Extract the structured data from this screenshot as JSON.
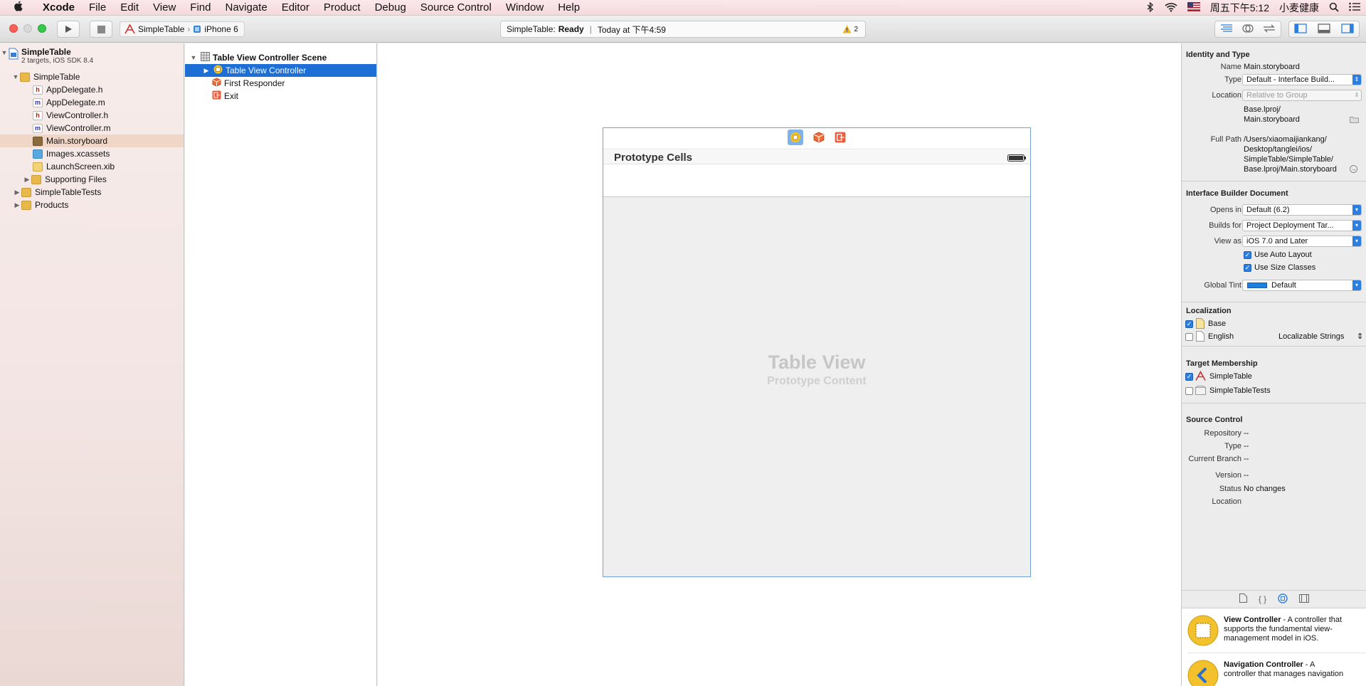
{
  "menubar": {
    "apple": "",
    "items": [
      "Xcode",
      "File",
      "Edit",
      "View",
      "Find",
      "Navigate",
      "Editor",
      "Product",
      "Debug",
      "Source Control",
      "Window",
      "Help"
    ],
    "clock": "周五下午5:12",
    "user": "小麦健康"
  },
  "toolbar": {
    "scheme": "SimpleTable",
    "device": "iPhone 6",
    "activity_project": "SimpleTable:",
    "activity_status": "Ready",
    "activity_time": "Today at 下午4:59",
    "warning_count": "2"
  },
  "navigator": {
    "project_name": "SimpleTable",
    "project_sub": "2 targets, iOS SDK 8.4",
    "items": [
      {
        "label": "SimpleTable",
        "icon": "folder"
      },
      {
        "label": "AppDelegate.h",
        "icon": "h"
      },
      {
        "label": "AppDelegate.m",
        "icon": "m"
      },
      {
        "label": "ViewController.h",
        "icon": "h"
      },
      {
        "label": "ViewController.m",
        "icon": "m"
      },
      {
        "label": "Main.storyboard",
        "icon": "storyboard"
      },
      {
        "label": "Images.xcassets",
        "icon": "xcassets"
      },
      {
        "label": "LaunchScreen.xib",
        "icon": "xib"
      },
      {
        "label": "Supporting Files",
        "icon": "folder"
      },
      {
        "label": "SimpleTableTests",
        "icon": "folder"
      },
      {
        "label": "Products",
        "icon": "folder"
      }
    ]
  },
  "outline": {
    "scene": "Table View Controller Scene",
    "items": [
      "Table View Controller",
      "First Responder",
      "Exit"
    ]
  },
  "canvas": {
    "prototype_cells": "Prototype Cells",
    "table_view": "Table View",
    "prototype_content": "Prototype Content"
  },
  "inspector": {
    "identity": {
      "title": "Identity and Type",
      "name_label": "Name",
      "name": "Main.storyboard",
      "type_label": "Type",
      "type": "Default - Interface Build...",
      "location_label": "Location",
      "location": "Relative to Group",
      "location_path_1": "Base.lproj/",
      "location_path_2": "Main.storyboard",
      "full_path_label": "Full Path",
      "full_path_1": "/Users/xiaomaijiankang/",
      "full_path_2": "Desktop/tanglei/ios/",
      "full_path_3": "SimpleTable/SimpleTable/",
      "full_path_4": "Base.lproj/Main.storyboard"
    },
    "ib_doc": {
      "title": "Interface Builder Document",
      "opens_in_label": "Opens in",
      "opens_in": "Default (6.2)",
      "builds_for_label": "Builds for",
      "builds_for": "Project Deployment Tar...",
      "view_as_label": "View as",
      "view_as": "iOS 7.0 and Later",
      "auto_layout": "Use Auto Layout",
      "size_classes": "Use Size Classes",
      "global_tint_label": "Global Tint",
      "global_tint": "Default",
      "tint_color": "#1d7fe0"
    },
    "localization": {
      "title": "Localization",
      "base": "Base",
      "english": "English",
      "english_type": "Localizable Strings"
    },
    "target": {
      "title": "Target Membership",
      "t1": "SimpleTable",
      "t2": "SimpleTableTests"
    },
    "source_control": {
      "title": "Source Control",
      "repository_label": "Repository",
      "repository": "--",
      "type_label": "Type",
      "type": "--",
      "branch_label": "Current Branch",
      "branch": "--",
      "version_label": "Version",
      "version": "--",
      "status_label": "Status",
      "status": "No changes",
      "location_label": "Location"
    },
    "library": {
      "vc_title": "View Controller",
      "vc_desc_1": " - A controller that",
      "vc_desc_2": "supports the fundamental view-",
      "vc_desc_3": "management model in iOS.",
      "nc_title": "Navigation Controller",
      "nc_desc_1": " - A",
      "nc_desc_2": "controller that manages navigation"
    }
  },
  "colors": {
    "selection": "#1d6fd6",
    "accent": "#2c7fe0"
  }
}
